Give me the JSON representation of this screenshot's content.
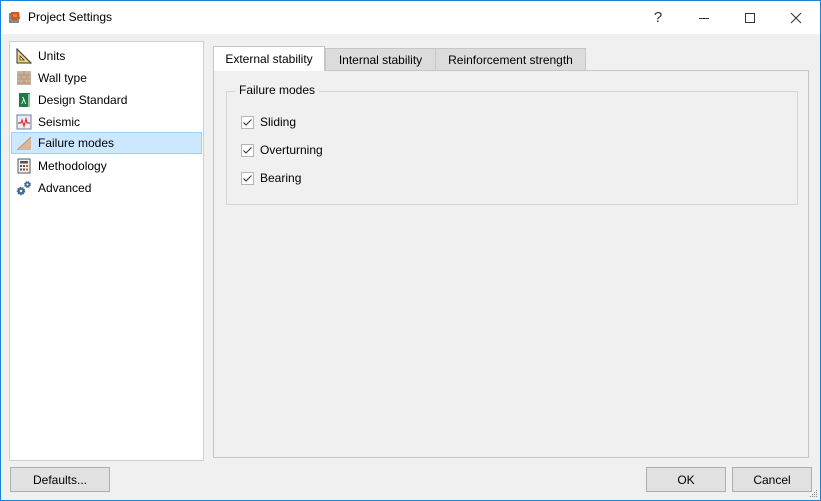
{
  "window": {
    "title": "Project Settings",
    "app_icon": "app-logo-icon",
    "controls": {
      "help": "?",
      "minimize": "minimize-icon",
      "maximize": "maximize-icon",
      "close": "close-icon"
    }
  },
  "sidebar": {
    "items": [
      {
        "label": "Units",
        "icon": "set-square-icon",
        "selected": false
      },
      {
        "label": "Wall type",
        "icon": "brick-wall-icon",
        "selected": false
      },
      {
        "label": "Design Standard",
        "icon": "design-standard-book-icon",
        "selected": false
      },
      {
        "label": "Seismic",
        "icon": "seismograph-icon",
        "selected": false
      },
      {
        "label": "Failure modes",
        "icon": "slope-wedge-icon",
        "selected": true
      },
      {
        "label": "Methodology",
        "icon": "calculator-icon",
        "selected": false
      },
      {
        "label": "Advanced",
        "icon": "gears-icon",
        "selected": false
      }
    ]
  },
  "tabs": [
    {
      "label": "External stability",
      "active": true
    },
    {
      "label": "Internal stability",
      "active": false
    },
    {
      "label": "Reinforcement strength",
      "active": false
    }
  ],
  "failure_modes_group": {
    "title": "Failure modes",
    "options": [
      {
        "label": "Sliding",
        "checked": true
      },
      {
        "label": "Overturning",
        "checked": true
      },
      {
        "label": "Bearing",
        "checked": true
      }
    ]
  },
  "footer": {
    "defaults_label": "Defaults...",
    "ok_label": "OK",
    "cancel_label": "Cancel"
  },
  "colors": {
    "window_border": "#1883d7",
    "selection_bg": "#cce8ff",
    "selection_border": "#99d1ff"
  }
}
